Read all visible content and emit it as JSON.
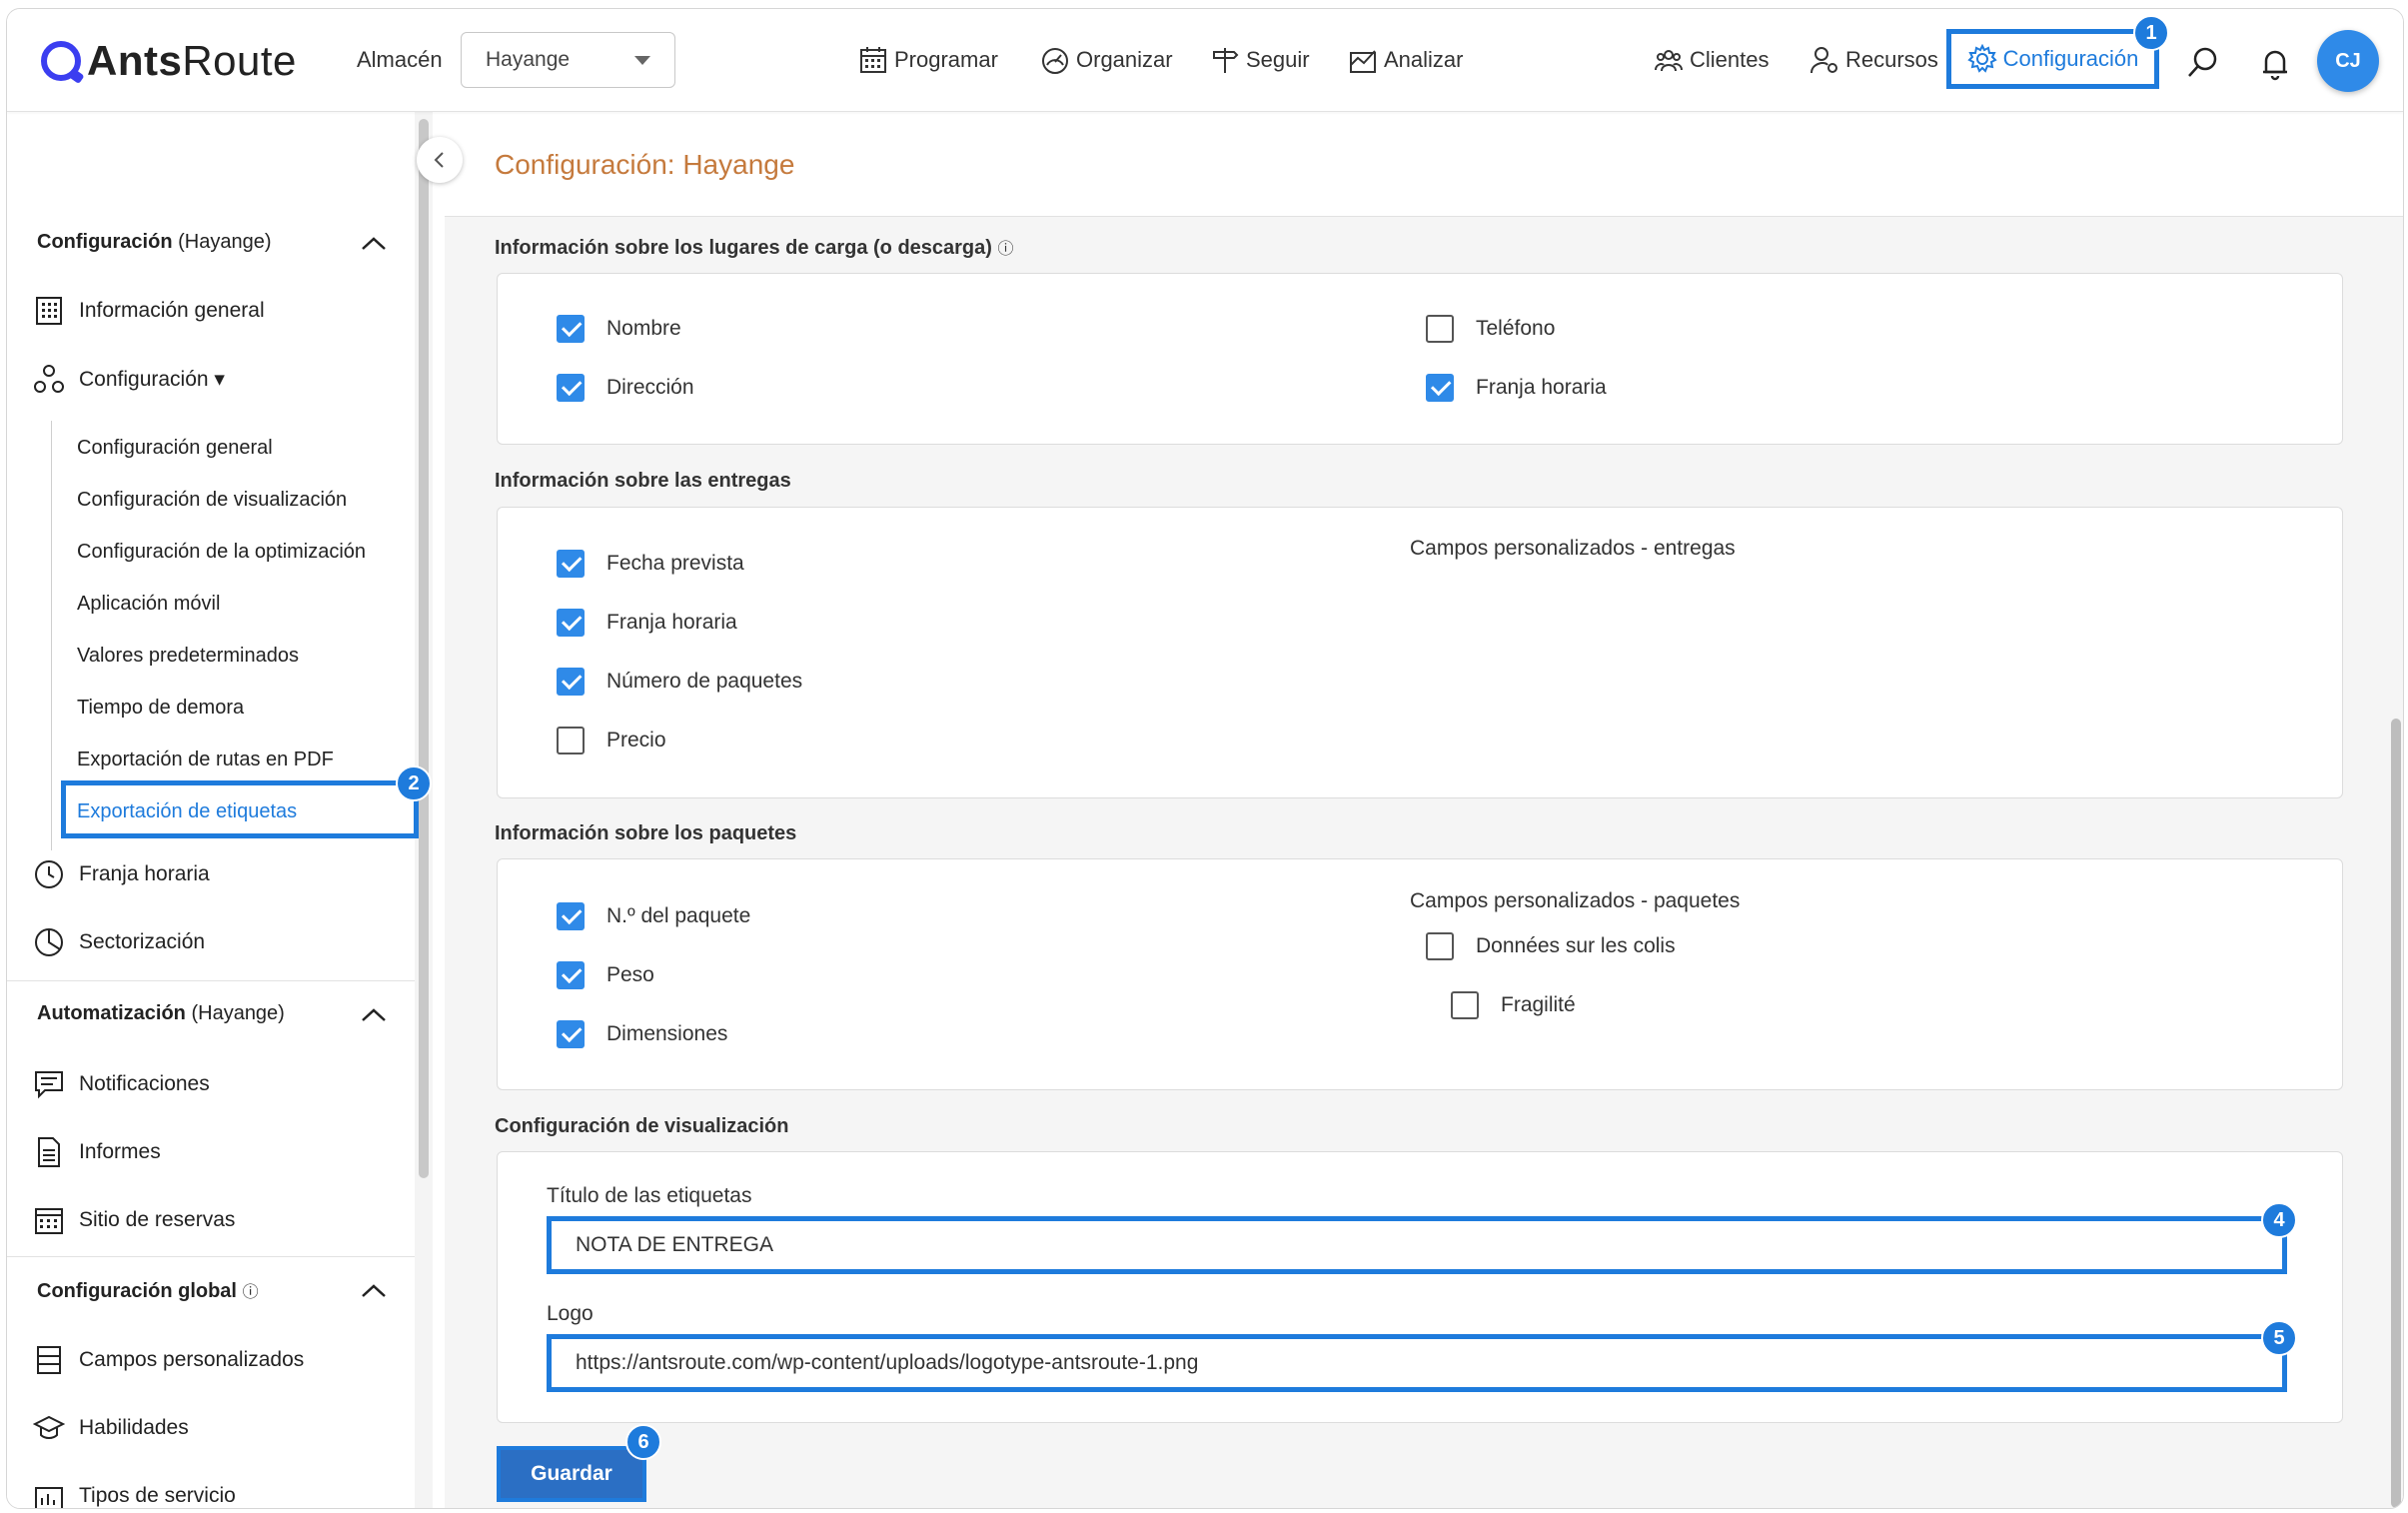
{
  "app": {
    "logo_bold": "Ants",
    "logo_rest": "Route"
  },
  "header": {
    "warehouse_label": "Almacén",
    "warehouse_value": "Hayange",
    "nav": [
      "Programar",
      "Organizar",
      "Seguir",
      "Analizar"
    ],
    "clients": "Clientes",
    "resources": "Recursos",
    "configuration": "Configuración",
    "avatar_initials": "CJ"
  },
  "badges": [
    "1",
    "2",
    "4",
    "5",
    "6"
  ],
  "sidebar": {
    "section_config_bold": "Configuración",
    "section_config_rest": " (Hayange)",
    "general_info": "Información general",
    "configuration": "Configuración ▾",
    "sub_items": [
      "Configuración general",
      "Configuración de visualización",
      "Configuración de la optimización",
      "Aplicación móvil",
      "Valores predeterminados",
      "Tiempo de demora",
      "Exportación de rutas en PDF",
      "Exportación de etiquetas"
    ],
    "time_window": "Franja horaria",
    "sectorization": "Sectorización",
    "section_auto_bold": "Automatización",
    "section_auto_rest": " (Hayange)",
    "notifications": "Notificaciones",
    "reports": "Informes",
    "booking_site": "Sitio de reservas",
    "section_global_bold": "Configuración global",
    "custom_fields": "Campos personalizados",
    "skills": "Habilidades",
    "service_types": "Tipos de servicio"
  },
  "main": {
    "title": "Configuración: Hayange",
    "places": {
      "title": "Información sobre los lugares de carga (o descarga)",
      "items": [
        {
          "label": "Nombre",
          "checked": true
        },
        {
          "label": "Dirección",
          "checked": true
        },
        {
          "label": "Teléfono",
          "checked": false
        },
        {
          "label": "Franja horaria",
          "checked": true
        }
      ]
    },
    "deliveries": {
      "title": "Información sobre las entregas",
      "custom_title": "Campos personalizados - entregas",
      "items": [
        {
          "label": "Fecha prevista",
          "checked": true
        },
        {
          "label": "Franja horaria",
          "checked": true
        },
        {
          "label": "Número de paquetes",
          "checked": true
        },
        {
          "label": "Precio",
          "checked": false
        }
      ]
    },
    "packages": {
      "title": "Información sobre los paquetes",
      "custom_title": "Campos personalizados - paquetes",
      "items": [
        {
          "label": "N.º del paquete",
          "checked": true
        },
        {
          "label": "Peso",
          "checked": true
        },
        {
          "label": "Dimensiones",
          "checked": true
        },
        {
          "label": "Données sur les colis",
          "checked": false
        },
        {
          "label": "Fragilité",
          "checked": false
        }
      ]
    },
    "display": {
      "title": "Configuración de visualización",
      "label_title_label": "Título de las etiquetas",
      "label_title_value": "NOTA DE ENTREGA",
      "logo_label": "Logo",
      "logo_value": "https://antsroute.com/wp-content/uploads/logotype-antsroute-1.png"
    },
    "save": "Guardar"
  }
}
